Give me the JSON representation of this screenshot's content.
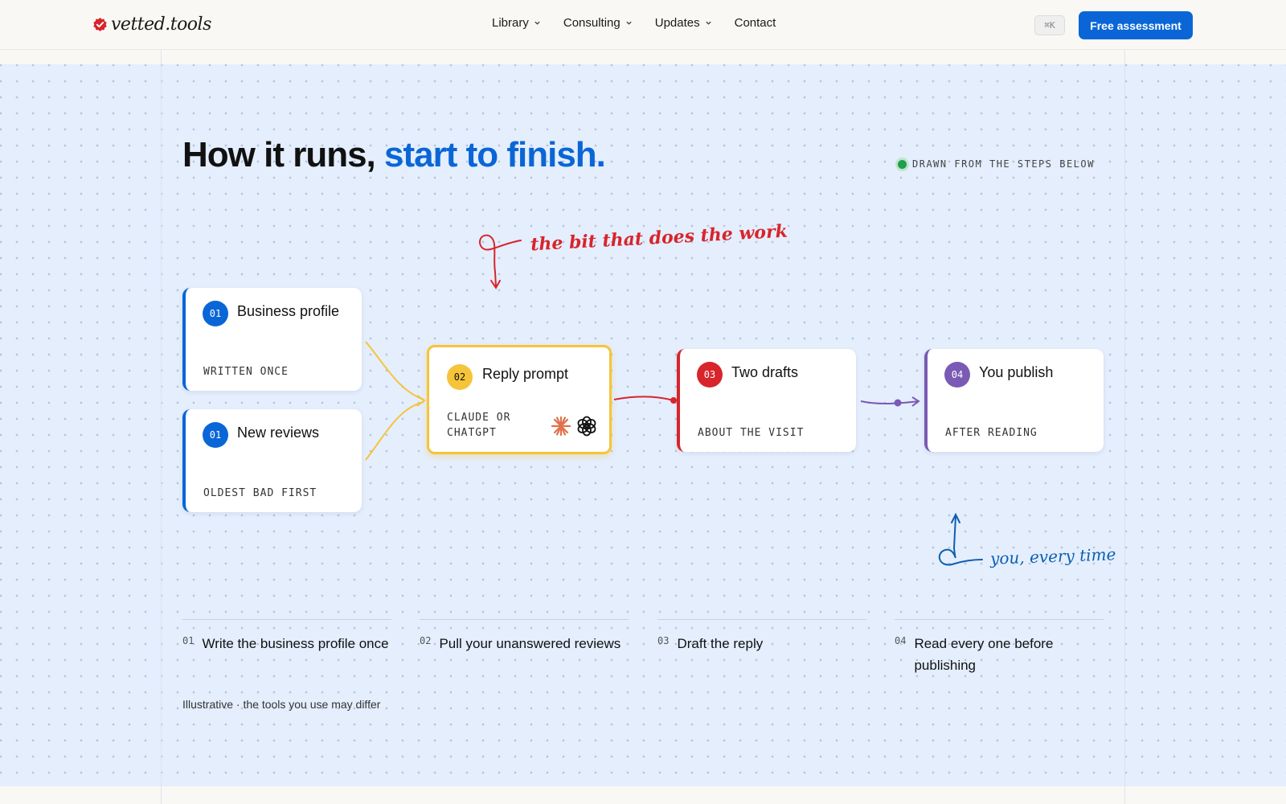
{
  "header": {
    "brand": "vetted.tools",
    "nav": [
      {
        "label": "Library",
        "has_menu": true
      },
      {
        "label": "Consulting",
        "has_menu": true
      },
      {
        "label": "Updates",
        "has_menu": true
      },
      {
        "label": "Contact",
        "has_menu": false
      }
    ],
    "shortcut": "⌘K",
    "cta_label": "Free assessment"
  },
  "hero": {
    "title_plain": "How it runs, ",
    "title_accent": "start to finish.",
    "status_label": "DRAWN FROM THE STEPS BELOW"
  },
  "flow": {
    "annotation_top": "the bit that does the work",
    "annotation_bottom": "you, every time",
    "cards": [
      {
        "num": "01",
        "title": "Business profile",
        "subtitle": "WRITTEN ONCE",
        "color": "#0a66d6"
      },
      {
        "num": "01",
        "title": "New reviews",
        "subtitle": "OLDEST BAD FIRST",
        "color": "#0a66d6"
      },
      {
        "num": "02",
        "title": "Reply prompt",
        "subtitle_line1": "CLAUDE OR",
        "subtitle_line2": "CHATGPT",
        "color": "#f5c43a",
        "icons": [
          "claude-icon",
          "openai-icon"
        ]
      },
      {
        "num": "03",
        "title": "Two drafts",
        "subtitle": "ABOUT THE VISIT",
        "color": "#d8242b"
      },
      {
        "num": "04",
        "title": "You publish",
        "subtitle": "AFTER READING",
        "color": "#7a5ab5"
      }
    ]
  },
  "steps": [
    {
      "num": "01",
      "text": "Write the business profile once"
    },
    {
      "num": "02",
      "text": "Pull your unanswered reviews"
    },
    {
      "num": "03",
      "text": "Draft the reply"
    },
    {
      "num": "04",
      "text": "Read every one before publishing"
    }
  ],
  "footnote": "Illustrative · the tools you use may differ",
  "colors": {
    "accent": "#0a66d6",
    "background": "#e4eefd",
    "status": "#1f9e4d"
  }
}
